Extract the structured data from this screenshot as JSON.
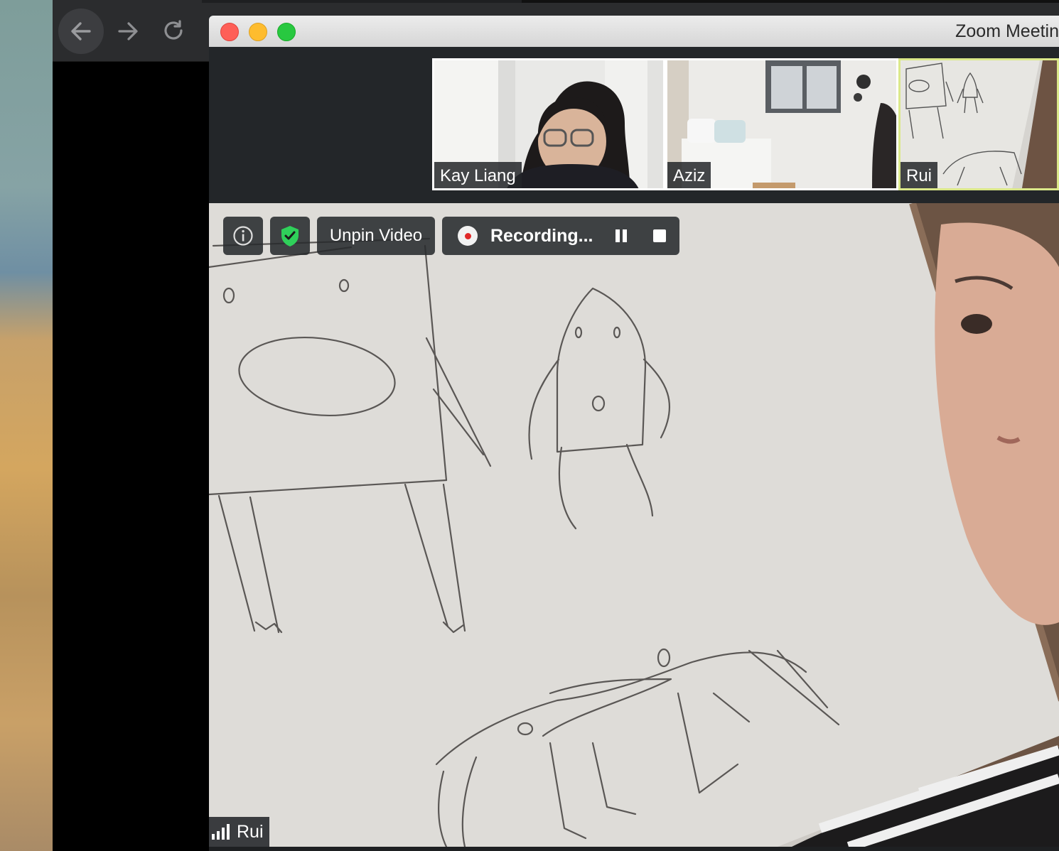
{
  "browser": {
    "nav": {
      "back_icon": "arrow-left-icon",
      "forward_icon": "arrow-right-icon",
      "reload_icon": "reload-icon"
    }
  },
  "zoom": {
    "window_title": "Zoom Meetin",
    "participants": [
      {
        "name": "Kay Liang",
        "active": false
      },
      {
        "name": "Aziz",
        "active": false
      },
      {
        "name": "Rui",
        "active": true
      }
    ],
    "controls": {
      "info_icon": "info-icon",
      "security_icon": "shield-check-icon",
      "unpin_label": "Unpin Video",
      "recording_label": "Recording...",
      "pause_icon": "pause-icon",
      "stop_icon": "stop-icon"
    },
    "main_video": {
      "speaker_name": "Rui",
      "signal_icon": "signal-bars-icon"
    },
    "colors": {
      "active_speaker_border": "#dbe88a",
      "record_dot": "#e02828",
      "shield_green": "#2fd05a"
    }
  }
}
